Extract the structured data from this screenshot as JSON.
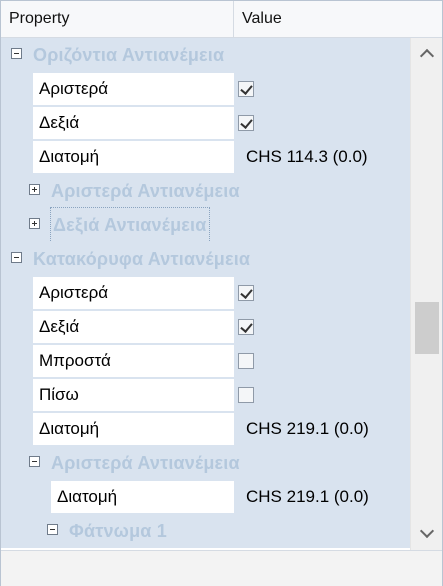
{
  "header": {
    "property_label": "Property",
    "value_label": "Value"
  },
  "rows": [
    {
      "kind": "category",
      "label": "Οριζόντια Αντιανέμεια",
      "expanded": true
    },
    {
      "kind": "checkbox",
      "name": "Αριστερά",
      "checked": true
    },
    {
      "kind": "checkbox",
      "name": "Δεξιά",
      "checked": true
    },
    {
      "kind": "text",
      "name": "Διατομή",
      "value": "CHS 114.3 (0.0)"
    },
    {
      "kind": "subcategory",
      "label": "Αριστερά Αντιανέμεια",
      "expanded": false
    },
    {
      "kind": "subcategory",
      "label": "Δεξιά Αντιανέμεια",
      "expanded": false,
      "focused": true
    },
    {
      "kind": "category",
      "label": "Κατακόρυφα Αντιανέμεια",
      "expanded": true
    },
    {
      "kind": "checkbox",
      "name": "Αριστερά",
      "checked": true
    },
    {
      "kind": "checkbox",
      "name": "Δεξιά",
      "checked": true
    },
    {
      "kind": "checkbox",
      "name": "Μπροστά",
      "checked": false
    },
    {
      "kind": "checkbox",
      "name": "Πίσω",
      "checked": false
    },
    {
      "kind": "text",
      "name": "Διατομή",
      "value": "CHS 219.1 (0.0)"
    },
    {
      "kind": "subcategory",
      "label": "Αριστερά Αντιανέμεια",
      "expanded": true
    },
    {
      "kind": "text",
      "name": "Διατομή",
      "value": "CHS 219.1 (0.0)",
      "indent": 2
    },
    {
      "kind": "subsub",
      "label": "Φάτνωμα 1",
      "expanded": true
    }
  ],
  "scrollbar": {
    "up_icon": "chevron-up-icon",
    "down_icon": "chevron-down-icon"
  },
  "colors": {
    "category_bg": "#d9e3ef",
    "category_text": "#b4c8dd"
  }
}
